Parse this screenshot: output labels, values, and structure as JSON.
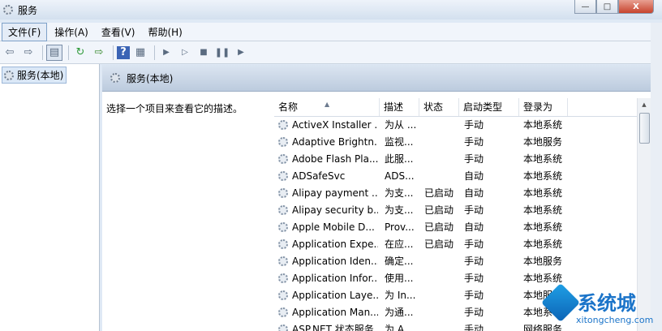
{
  "window": {
    "title": "服务",
    "min": "—",
    "max": "□",
    "close": "X"
  },
  "menu": [
    {
      "label": "文件(F)"
    },
    {
      "label": "操作(A)"
    },
    {
      "label": "查看(V)"
    },
    {
      "label": "帮助(H)"
    }
  ],
  "toolbar": {
    "icons": [
      "back-arrow-icon",
      "forward-arrow-icon",
      "show-tree-icon",
      "refresh-icon",
      "export-icon",
      "help-icon",
      "properties-icon",
      "start-service-icon",
      "start-service-alt-icon",
      "stop-service-icon",
      "pause-service-icon",
      "restart-service-icon"
    ]
  },
  "tree": {
    "root": "服务(本地)"
  },
  "panel": {
    "header": "服务(本地)",
    "description": "选择一个项目来查看它的描述。"
  },
  "columns": {
    "name": "名称",
    "desc": "描述",
    "status": "状态",
    "startup": "启动类型",
    "logon": "登录为"
  },
  "services": [
    {
      "name": "ActiveX Installer ...",
      "desc": "为从 ...",
      "status": "",
      "startup": "手动",
      "logon": "本地系统"
    },
    {
      "name": "Adaptive Brightn...",
      "desc": "监视...",
      "status": "",
      "startup": "手动",
      "logon": "本地服务"
    },
    {
      "name": "Adobe Flash Pla...",
      "desc": "此服...",
      "status": "",
      "startup": "手动",
      "logon": "本地系统"
    },
    {
      "name": "ADSafeSvc",
      "desc": "ADS...",
      "status": "",
      "startup": "自动",
      "logon": "本地系统"
    },
    {
      "name": "Alipay payment ...",
      "desc": "为支...",
      "status": "已启动",
      "startup": "自动",
      "logon": "本地系统"
    },
    {
      "name": "Alipay security b...",
      "desc": "为支...",
      "status": "已启动",
      "startup": "手动",
      "logon": "本地系统"
    },
    {
      "name": "Apple Mobile D...",
      "desc": "Prov...",
      "status": "已启动",
      "startup": "自动",
      "logon": "本地系统"
    },
    {
      "name": "Application Expe...",
      "desc": "在应...",
      "status": "已启动",
      "startup": "手动",
      "logon": "本地系统"
    },
    {
      "name": "Application Iden...",
      "desc": "确定...",
      "status": "",
      "startup": "手动",
      "logon": "本地服务"
    },
    {
      "name": "Application Infor...",
      "desc": "使用...",
      "status": "",
      "startup": "手动",
      "logon": "本地系统"
    },
    {
      "name": "Application Laye...",
      "desc": "为 In...",
      "status": "",
      "startup": "手动",
      "logon": "本地服"
    },
    {
      "name": "Application Man...",
      "desc": "为通...",
      "status": "",
      "startup": "手动",
      "logon": "本地系"
    },
    {
      "name": "ASP.NET 状态服务",
      "desc": "为 A...",
      "status": "",
      "startup": "手动",
      "logon": "网络服务"
    }
  ],
  "watermark": {
    "name": "系统城",
    "url": "xitongcheng.com"
  },
  "colors": {
    "header_blue": "#bccbde",
    "selection": "#dbe8f7",
    "watermark": "#1b74c9"
  }
}
